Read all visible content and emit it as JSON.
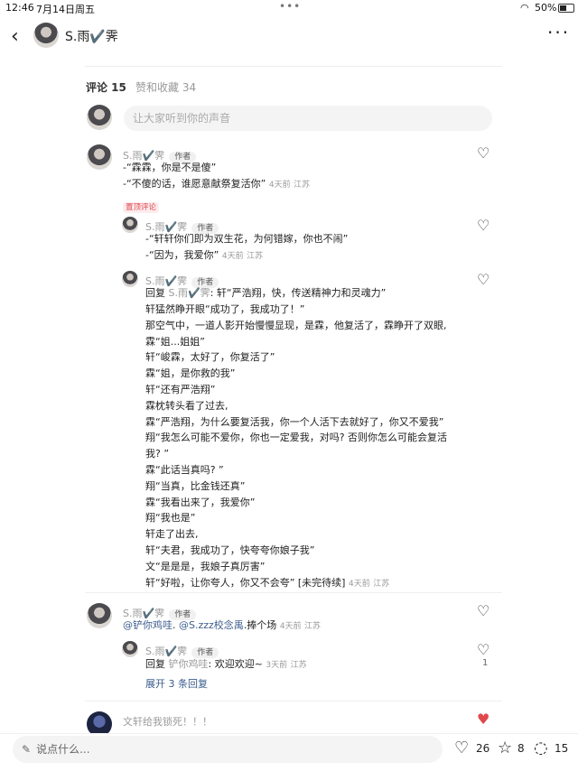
{
  "status_bar": {
    "time": "12:46",
    "date": "7月14日周五",
    "battery": "50%"
  },
  "header": {
    "back_icon": "chevron-left-icon",
    "username": "S.雨✔️霁",
    "more_icon": "more-horizontal-icon"
  },
  "tabs": [
    {
      "label": "评论 15",
      "active": true
    },
    {
      "label": "赞和收藏 34",
      "active": false
    }
  ],
  "comment_input": {
    "placeholder": "让大家听到你的声音"
  },
  "comments": {
    "c1": {
      "username": "S.雨✔️霁",
      "badge": "作者",
      "lines": [
        "-“霖霖，你是不是傻”",
        "-“不傻的话，谁愿意献祭复活你”"
      ],
      "time": "4天前",
      "location": "江苏",
      "pin": "置顶评论"
    },
    "r1": {
      "username": "S.雨✔️霁",
      "badge": "作者",
      "lines": [
        "-“轩轩你们即为双生花，为何错嫁，你也不闹”",
        "-“因为，我爱你”"
      ],
      "time": "4天前",
      "location": "江苏"
    },
    "r2": {
      "username": "S.雨✔️霁",
      "badge": "作者",
      "reply_prefix": "回复 ",
      "reply_to": "S.雨✔️霁",
      "first_line_rest": ": 轩“严浩翔，快，传送精神力和灵魂力”",
      "lines": [
        "轩猛然睁开眼“成功了，我成功了！”",
        "那空气中，一道人影开始慢慢显现，是霖，他复活了，霖睁开了双眼,",
        "霖“姐...姐姐”",
        "轩“峻霖，太好了，你复活了”",
        "霖“姐，是你救的我”",
        "轩“还有严浩翔”",
        "霖枕转头看了过去,",
        "霖“严浩翔，为什么要复活我，你一个人活下去就好了，你又不爱我”",
        "翔“我怎么可能不爱你，你也一定爱我，对吗? 否则你怎么可能会复活",
        "我? ”",
        "霖“此话当真吗? ”",
        "翔“当真，比金钱还真”",
        "霖“我看出来了，我爱你”",
        "翔“我也是”",
        "轩走了出去,",
        "轩“夫君，我成功了，快夸夸你娘子我”",
        "文“是是是，我娘子真厉害”",
        "轩“好啦，让你夸人，你又不会夸” [未完待续]"
      ],
      "time": "4天前",
      "location": "江苏"
    },
    "c2": {
      "username": "S.雨✔️霁",
      "badge": "作者",
      "mention1": "@铲你鸡哇",
      "mention2": "@S.zzz校念禹",
      "text_tail": ".捧个场",
      "time": "4天前",
      "location": "江苏"
    },
    "r3": {
      "username": "S.雨✔️霁",
      "badge": "作者",
      "reply_prefix": "回复 ",
      "reply_to": "铲你鸡哇",
      "text": ": 欢迎欢迎~",
      "time": "3天前",
      "location": "江苏",
      "likes": "1"
    },
    "expand": "展开 3 条回复",
    "c3": {
      "text": "文轩给我锁死！！！"
    }
  },
  "bottom_bar": {
    "placeholder": "说点什么...",
    "likes": "26",
    "stars": "8",
    "comments": "15"
  },
  "colors": {
    "accent_red": "#e0474c",
    "mention_blue": "#3b5b8c"
  }
}
